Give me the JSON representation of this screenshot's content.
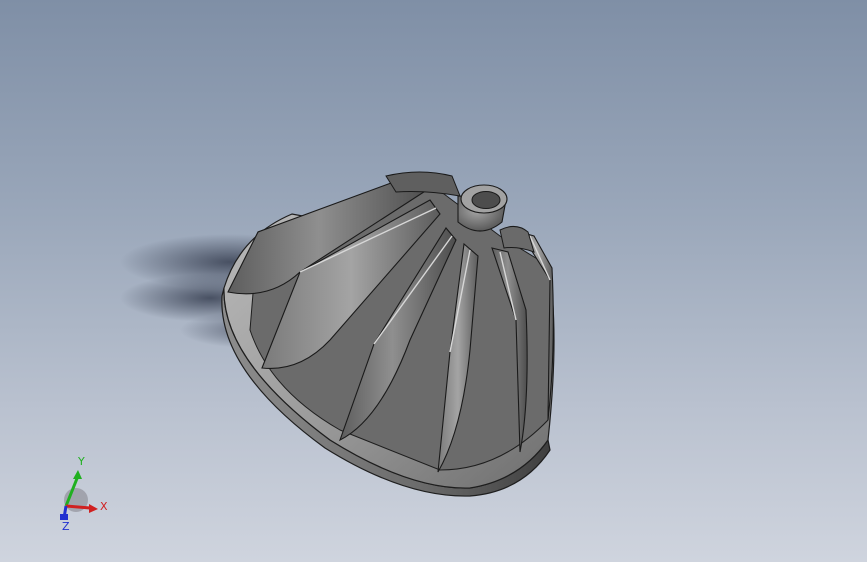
{
  "viewport": {
    "colors": {
      "bg_top": "#7f8fa6",
      "bg_bottom": "#cfd4de",
      "part_light": "#9a9a9a",
      "part_dark": "#4a4a4a",
      "shadow": "#5a6475"
    }
  },
  "model": {
    "name": "impeller-part",
    "blade_count": 10
  },
  "triad": {
    "x_label": "X",
    "y_label": "Y",
    "z_label": "Z",
    "colors": {
      "x": "#d02020",
      "y": "#20b020",
      "z": "#2030d0"
    }
  }
}
